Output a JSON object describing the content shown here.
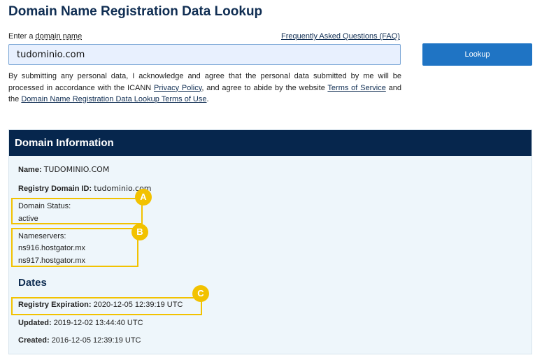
{
  "page": {
    "title": "Domain Name Registration Data Lookup"
  },
  "search": {
    "label_prefix": "Enter a ",
    "label_link": "domain name",
    "faq_link": "Frequently Asked Questions (FAQ)",
    "value": "tudominio.com",
    "button_label": "Lookup"
  },
  "disclaimer": {
    "part1": "By submitting any personal data, I acknowledge and agree that the personal data submitted by me will be processed in accordance with the ICANN ",
    "privacy_link": "Privacy Policy",
    "part2": ", and agree to abide by the website ",
    "tos_link": "Terms of Service",
    "part3": " and the ",
    "lookup_terms_link": "Domain Name Registration Data Lookup Terms of Use",
    "part4": "."
  },
  "domain_info": {
    "header": "Domain Information",
    "name_label": "Name:",
    "name_value": "TUDOMINIO.COM",
    "registry_id_label": "Registry Domain ID:",
    "registry_id_value": "tudominio.com",
    "status_label": "Domain Status:",
    "status_value": "active",
    "nameservers_label": "Nameservers:",
    "nameservers": [
      "ns916.hostgator.mx",
      "ns917.hostgator.mx"
    ]
  },
  "dates": {
    "title": "Dates",
    "expiration_label": "Registry Expiration:",
    "expiration_value": "2020-12-05 12:39:19 UTC",
    "updated_label": "Updated:",
    "updated_value": "2019-12-02 13:44:40 UTC",
    "created_label": "Created:",
    "created_value": "2016-12-05 12:39:19 UTC"
  },
  "annotations": {
    "a": "A",
    "b": "B",
    "c": "C",
    "color": "#f2c200"
  },
  "colors": {
    "title": "#0f2d52",
    "header_bg": "#06264d",
    "button_bg": "#1f74c4",
    "card_bg": "#eef6fb",
    "input_bg": "#e8f0fe"
  }
}
